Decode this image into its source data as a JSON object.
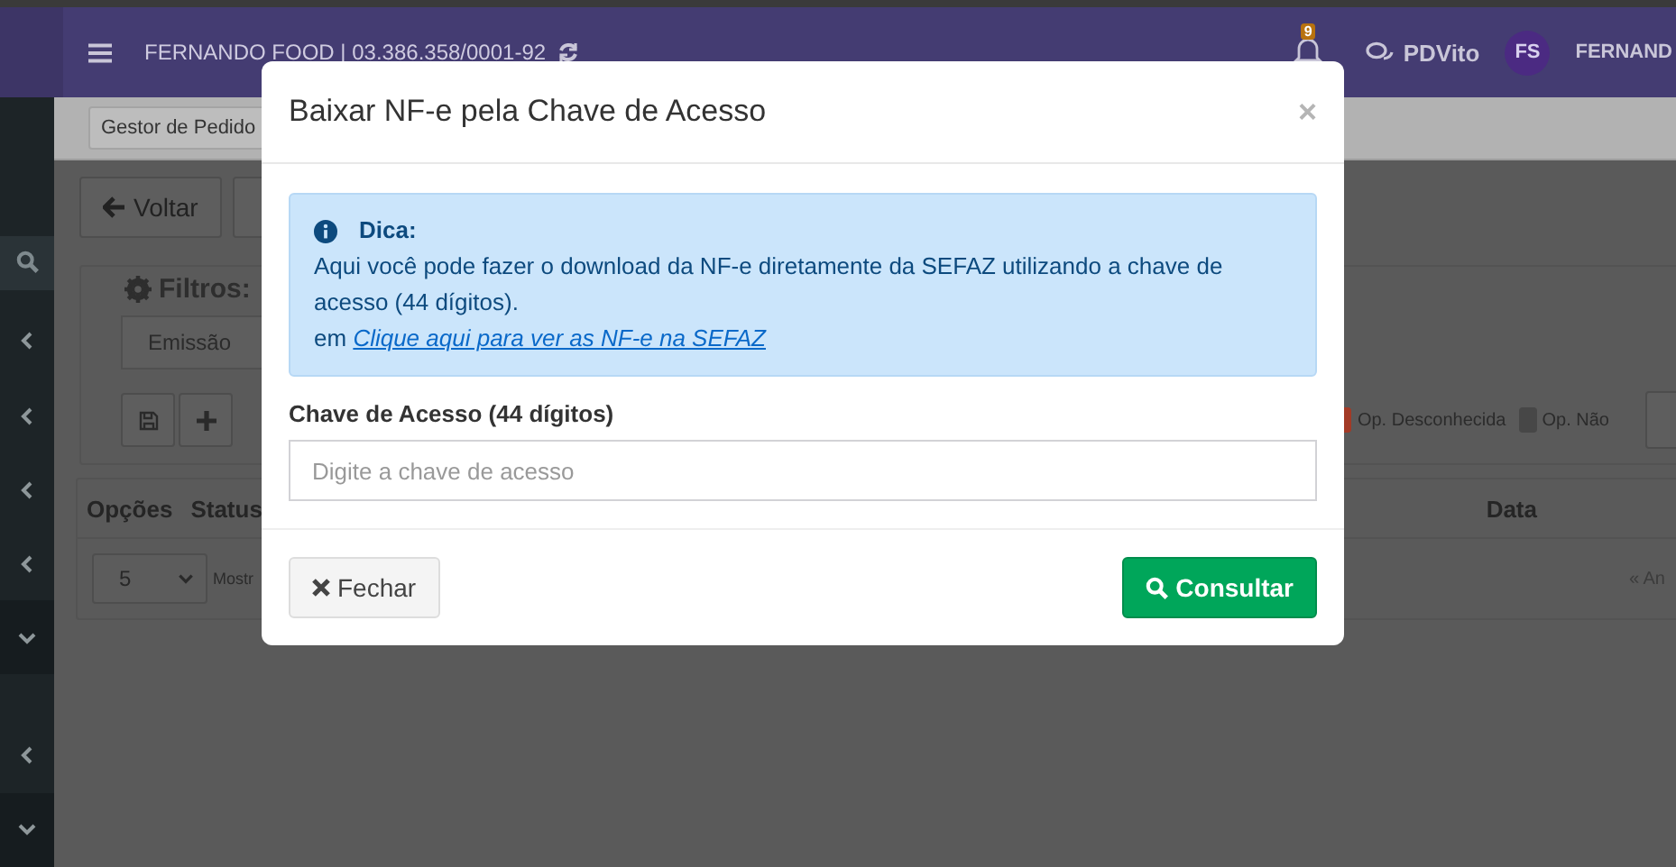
{
  "header": {
    "company": "FERNANDO FOOD | 03.386.358/0001-92",
    "notification_count": "9",
    "chat_label": "PDVito",
    "avatar_initials": "FS",
    "user_name": "FERNAND"
  },
  "breadcrumb": {
    "tab": "Gestor de Pedido"
  },
  "sidebar": {
    "items": [
      {
        "expanded": false
      },
      {
        "expanded": false
      },
      {
        "expanded": false
      },
      {
        "expanded": false
      },
      {
        "expanded": true
      },
      {
        "expanded": false
      },
      {
        "expanded": true
      }
    ]
  },
  "toolbar": {
    "buttons": [
      "Voltar"
    ]
  },
  "filters": {
    "title": "Filtros:",
    "date_field": "Emissão",
    "legend": [
      {
        "label": "Op. Desconhecida",
        "color": "#a33a26"
      },
      {
        "label": "Op. Não",
        "color": "#474747"
      }
    ]
  },
  "table": {
    "columns": [
      "Opções",
      "Status",
      "Data"
    ],
    "page_size": "5",
    "page_size_label": "Mostr",
    "pager": "« An"
  },
  "modal": {
    "title": "Baixar NF-e pela Chave de Acesso",
    "close_symbol": "×",
    "tip": {
      "title": "Dica:",
      "text": "Aqui você pode fazer o download da NF-e diretamente da SEFAZ utilizando a chave de acesso (44 dígitos).",
      "prefix": "em",
      "link": "Clique aqui para ver as NF-e na SEFAZ"
    },
    "field": {
      "label": "Chave de Acesso (44 dígitos)",
      "placeholder": "Digite a chave de acesso"
    },
    "buttons": [
      {
        "label": "Fechar",
        "kind": "close"
      },
      {
        "label": "Consultar",
        "kind": "search"
      }
    ]
  }
}
